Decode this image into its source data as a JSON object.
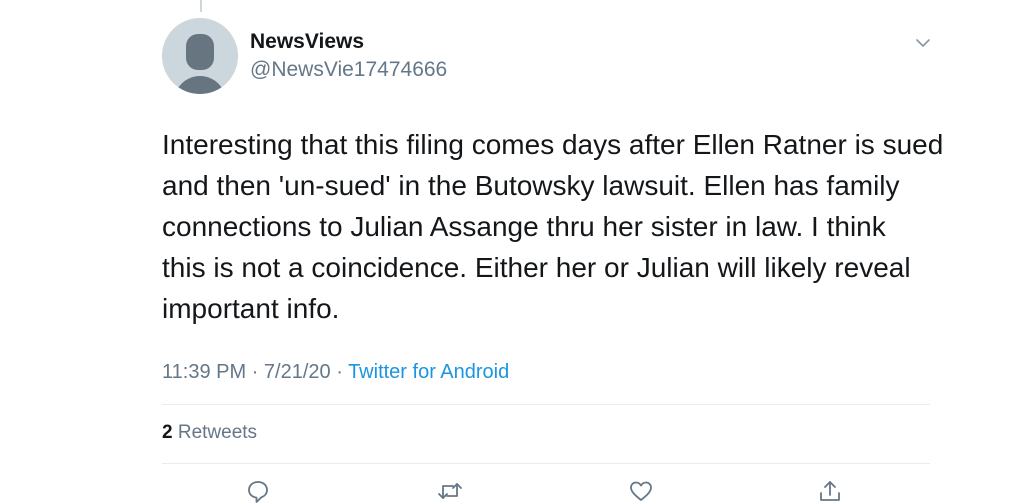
{
  "tweet": {
    "author": {
      "display_name": "NewsViews",
      "handle": "@NewsVie17474666"
    },
    "text": "Interesting that this filing comes days after Ellen Ratner is sued\nand then 'un-sued' in the Butowsky lawsuit.  Ellen has family\nconnections to Julian Assange thru her sister in law.  I think\nthis is not a coincidence.  Either her or Julian will likely reveal\nimportant info.",
    "time": "11:39 PM",
    "separator_1": " · ",
    "date": "7/21/20",
    "separator_2": " · ",
    "source": "Twitter for Android",
    "stats": {
      "retweet_count": "2",
      "retweet_label": "Retweets"
    }
  },
  "icons": {
    "avatar": "default-avatar-icon",
    "menu": "chevron-down-icon",
    "reply": "reply-icon",
    "retweet": "retweet-icon",
    "like": "heart-icon",
    "share": "share-icon"
  },
  "colors": {
    "primary_text": "#14171a",
    "secondary_text": "#657786",
    "link": "#1b95e0",
    "divider": "#e6ecf0",
    "avatar_bg": "#ccd6dd",
    "avatar_fg": "#66757f"
  }
}
